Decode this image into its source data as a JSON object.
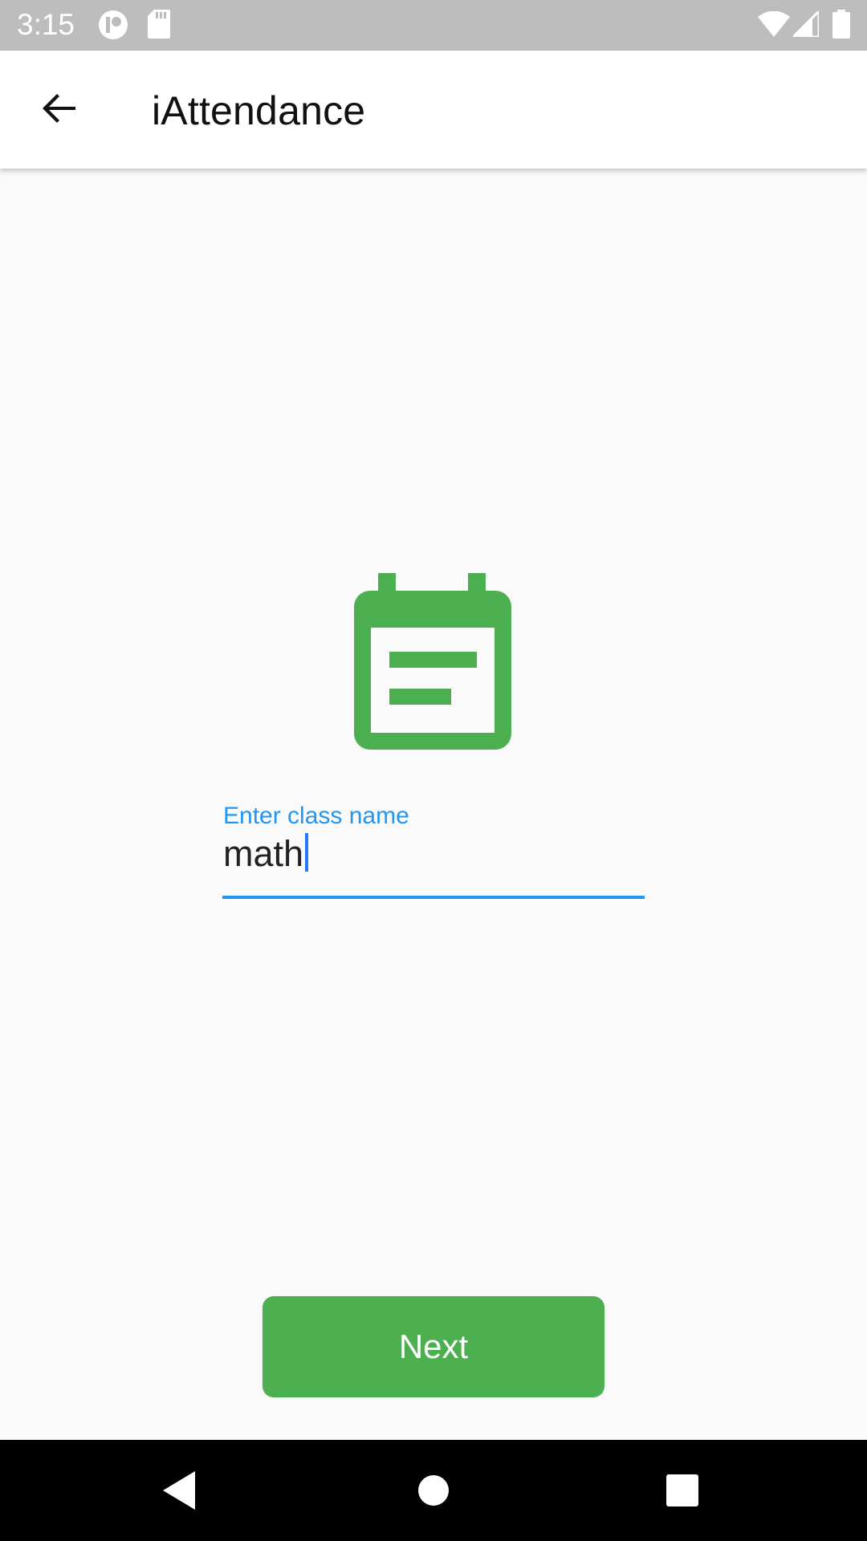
{
  "status_bar": {
    "time": "3:15",
    "background": "#bdbdbd",
    "icons": [
      "circle-app-icon",
      "sd-card-icon",
      "wifi-icon",
      "cellular-signal-icon",
      "battery-icon"
    ]
  },
  "app_bar": {
    "title": "iAttendance",
    "back_icon": "arrow-back-icon"
  },
  "main": {
    "icon": "calendar-event-icon",
    "icon_color": "#4caf50",
    "class_name_field": {
      "label": "Enter class name",
      "value": "math",
      "accent_color": "#2196f3"
    },
    "next_button": {
      "label": "Next",
      "color": "#4caf50"
    }
  },
  "nav_bar": {
    "icons": [
      "nav-back-icon",
      "nav-home-icon",
      "nav-recents-icon"
    ]
  }
}
